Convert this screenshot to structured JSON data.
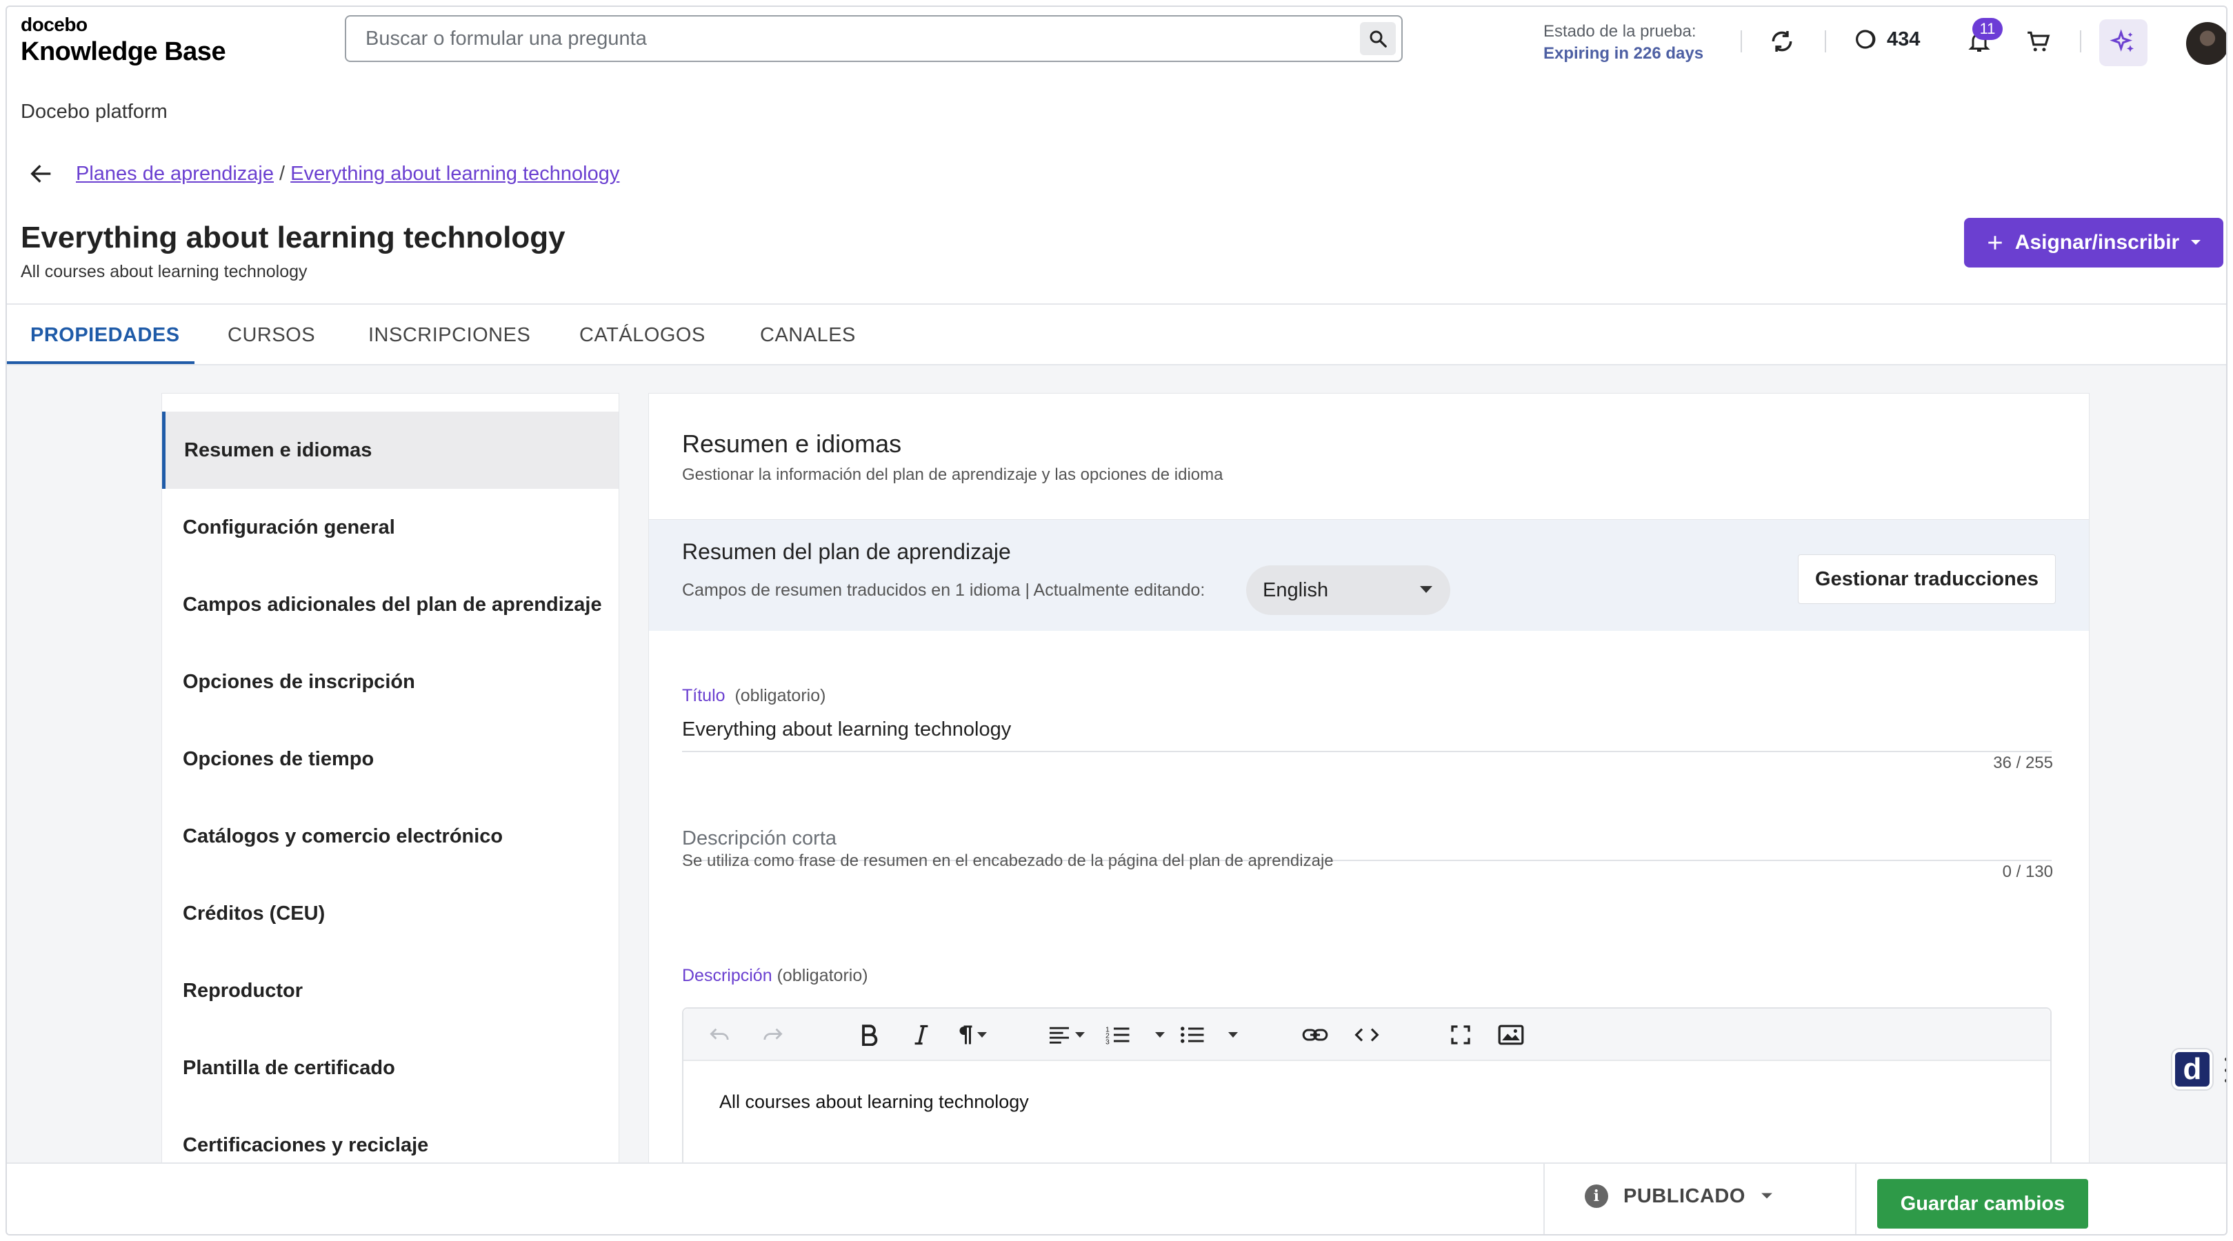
{
  "header": {
    "logo_small": "docebo",
    "logo_big": "Knowledge Base",
    "search_placeholder": "Buscar o formular una pregunta",
    "trial_label": "Estado de la prueba:",
    "trial_value": "Expiring in 226 days",
    "coins": "434",
    "notifications_count": "11"
  },
  "platform_label": "Docebo platform",
  "breadcrumb": {
    "item1": "Planes de aprendizaje",
    "separator": "/",
    "item2": "Everything about learning technology"
  },
  "page": {
    "title": "Everything about learning technology",
    "subtitle": "All courses about learning technology",
    "assign_button": "Asignar/inscribir"
  },
  "tabs": [
    {
      "label": "PROPIEDADES",
      "active": true
    },
    {
      "label": "CURSOS"
    },
    {
      "label": "INSCRIPCIONES"
    },
    {
      "label": "CATÁLOGOS"
    },
    {
      "label": "CANALES"
    }
  ],
  "sidebar": {
    "items": [
      {
        "label": "Resumen e idiomas",
        "active": true
      },
      {
        "label": "Configuración general"
      },
      {
        "label": "Campos adicionales del plan de aprendizaje"
      },
      {
        "label": "Opciones de inscripción"
      },
      {
        "label": "Opciones de tiempo"
      },
      {
        "label": "Catálogos y comercio electrónico"
      },
      {
        "label": "Créditos (CEU)"
      },
      {
        "label": "Reproductor"
      },
      {
        "label": "Plantilla de certificado"
      },
      {
        "label": "Certificaciones y reciclaje"
      }
    ]
  },
  "main": {
    "title": "Resumen e idiomas",
    "subtitle": "Gestionar la información del plan de aprendizaje y las opciones de idioma",
    "summary": {
      "title": "Resumen del plan de aprendizaje",
      "subtitle": "Campos de resumen traducidos en 1 idioma | Actualmente editando:",
      "language": "English",
      "manage_translations": "Gestionar traducciones"
    },
    "title_field": {
      "label": "Título",
      "required": "(obligatorio)",
      "value": "Everything about learning technology",
      "counter": "36 / 255"
    },
    "short_desc_field": {
      "placeholder": "Descripción corta",
      "help": "Se utiliza como frase de resumen en el encabezado de la página del plan de aprendizaje",
      "counter": "0 / 130"
    },
    "description_field": {
      "label": "Descripción",
      "required": "(obligatorio)",
      "content": "All courses about learning technology"
    }
  },
  "float_badge": "d",
  "footer": {
    "status": "PUBLICADO",
    "save_button": "Guardar cambios"
  },
  "colors": {
    "accent_purple": "#6b3fd0",
    "tab_blue": "#1f5ba8",
    "save_green": "#2e9a48",
    "trial_blue": "#4d5fa3"
  }
}
